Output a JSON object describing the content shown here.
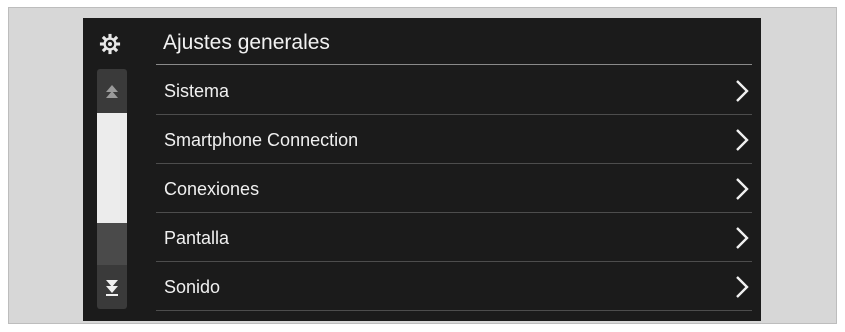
{
  "header": {
    "title": "Ajustes generales",
    "icon": "gear-icon"
  },
  "menu": {
    "items": [
      {
        "label": "Sistema"
      },
      {
        "label": "Smartphone Connection"
      },
      {
        "label": "Conexiones"
      },
      {
        "label": "Pantalla"
      },
      {
        "label": "Sonido"
      }
    ]
  },
  "colors": {
    "screen_bg": "#1b1b1b",
    "text": "#f0f0f0",
    "scroll_thumb": "#ececec",
    "divider": "#4d4d4d"
  }
}
